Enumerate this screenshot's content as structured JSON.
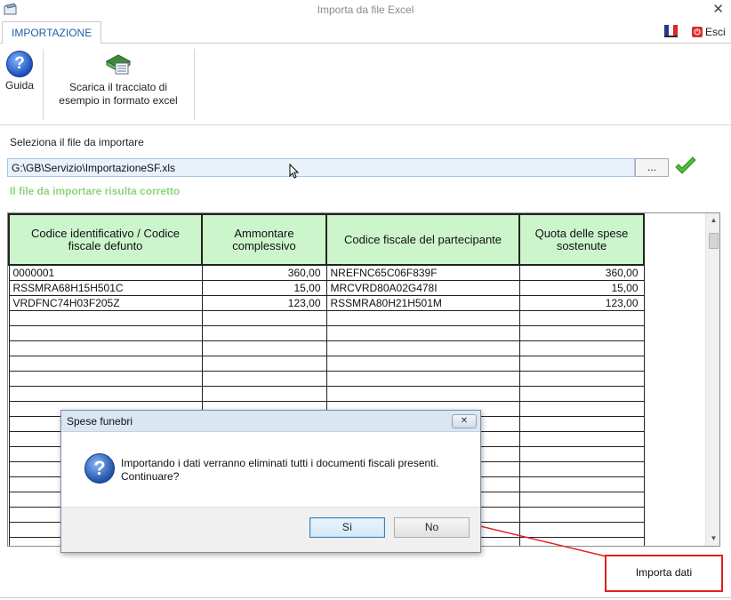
{
  "window": {
    "title": "Importa da file Excel",
    "close_glyph": "✕"
  },
  "ribbon": {
    "tab_label": "IMPORTAZIONE",
    "guida_label": "Guida",
    "scarica_line1": "Scarica il tracciato di",
    "scarica_line2": "esempio in formato excel",
    "esci_label": "Esci",
    "icons": [
      "app-icon",
      "flag-icon",
      "esci-icon",
      "help-icon",
      "excel-download-icon"
    ]
  },
  "form": {
    "select_label": "Seleziona il file da importare",
    "file_path": "G:\\GB\\Servizio\\ImportazioneSF.xls",
    "browse_label": "...",
    "status_message": "Il file da importare risulta corretto",
    "status_color": "#8ed67c"
  },
  "grid": {
    "headers": [
      "Codice identificativo / Codice fiscale defunto",
      "Ammontare complessivo",
      "Codice fiscale del partecipante",
      "Quota delle spese sostenute"
    ],
    "header_color": "#ccf5cc",
    "rows": [
      [
        "0000001",
        "360,00",
        "NREFNC65C06F839F",
        "360,00"
      ],
      [
        "RSSMRA68H15H501C",
        "15,00",
        "MRCVRD80A02G478I",
        "15,00"
      ],
      [
        "VRDFNC74H03F205Z",
        "123,00",
        "RSSMRA80H21H501M",
        "123,00"
      ]
    ]
  },
  "dialog": {
    "title": "Spese funebri",
    "message_line1": "Importando i dati verranno eliminati tutti i documenti fiscali presenti.",
    "message_line2": "Continuare?",
    "yes_label": "Sì",
    "no_label": "No",
    "close_glyph": "✕"
  },
  "footer": {
    "import_label": "Importa dati",
    "highlight_color": "#e02020"
  }
}
